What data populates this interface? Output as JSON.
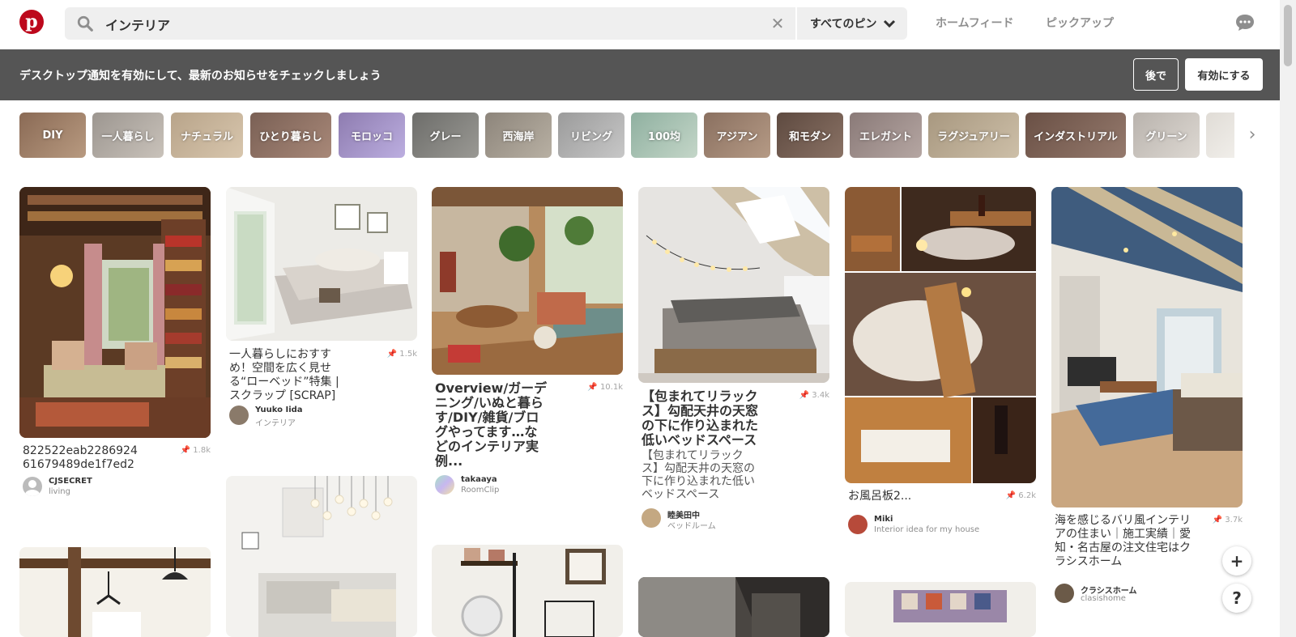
{
  "header": {
    "search_value": "インテリア",
    "scope_label": "すべてのピン",
    "nav_home": "ホームフィード",
    "nav_pickup": "ピックアップ"
  },
  "notification": {
    "text": "デスクトップ通知を有効にして、最新のお知らせをチェックしましょう",
    "later_label": "後で",
    "enable_label": "有効にする"
  },
  "categories": [
    "DIY",
    "一人暮らし",
    "ナチュラル",
    "ひとり暮らし",
    "モロッコ",
    "グレー",
    "西海岸",
    "リビング",
    "100均",
    "アジアン",
    "和モダン",
    "エレガント",
    "ラグジュアリー",
    "インダストリアル",
    "グリーン"
  ],
  "colors": {
    "brand": "#bd081c",
    "notify_bg": "#555555",
    "search_bg": "#efefef"
  },
  "pins": [
    {
      "title": "822522eab228692461679489de1f7ed2",
      "saves": "1.8k",
      "user": "CJSECRET",
      "board": "living"
    },
    {
      "title": "一人暮らしにおすすめ！空間を広く見せる“ローベッド”特集 | スクラップ [SCRAP]",
      "saves": "1.5k",
      "user": "Yuuko Iida",
      "board": "インテリア"
    },
    {
      "title": "Overview/ガーデニング/いぬと暮らす/DIY/雑貨/ブログやってます…などのインテリア実例...",
      "extra": "...",
      "saves": "10.1k",
      "user": "takaaya",
      "board": "RoomClip"
    },
    {
      "title": "【包まれてリラックス】勾配天井の天窓の下に作り込まれた低いベッドスペース",
      "desc": "【包まれてリラックス】勾配天井の天窓の下に作り込まれた低いベッドスペース",
      "saves": "3.4k",
      "user": "睦美田中",
      "board": "ベッドルーム"
    },
    {
      "title": "お風呂板2...",
      "saves": "6.2k",
      "user": "Miki",
      "board": "Interior idea for my house"
    },
    {
      "title": "海を感じるバリ風インテリアの住まい｜施工実績｜愛知・名古屋の注文住宅はクラシスホーム",
      "saves": "3.7k",
      "user": "クラシスホーム",
      "board": "clasishome"
    }
  ],
  "fab": {
    "plus": "+",
    "help": "?"
  }
}
